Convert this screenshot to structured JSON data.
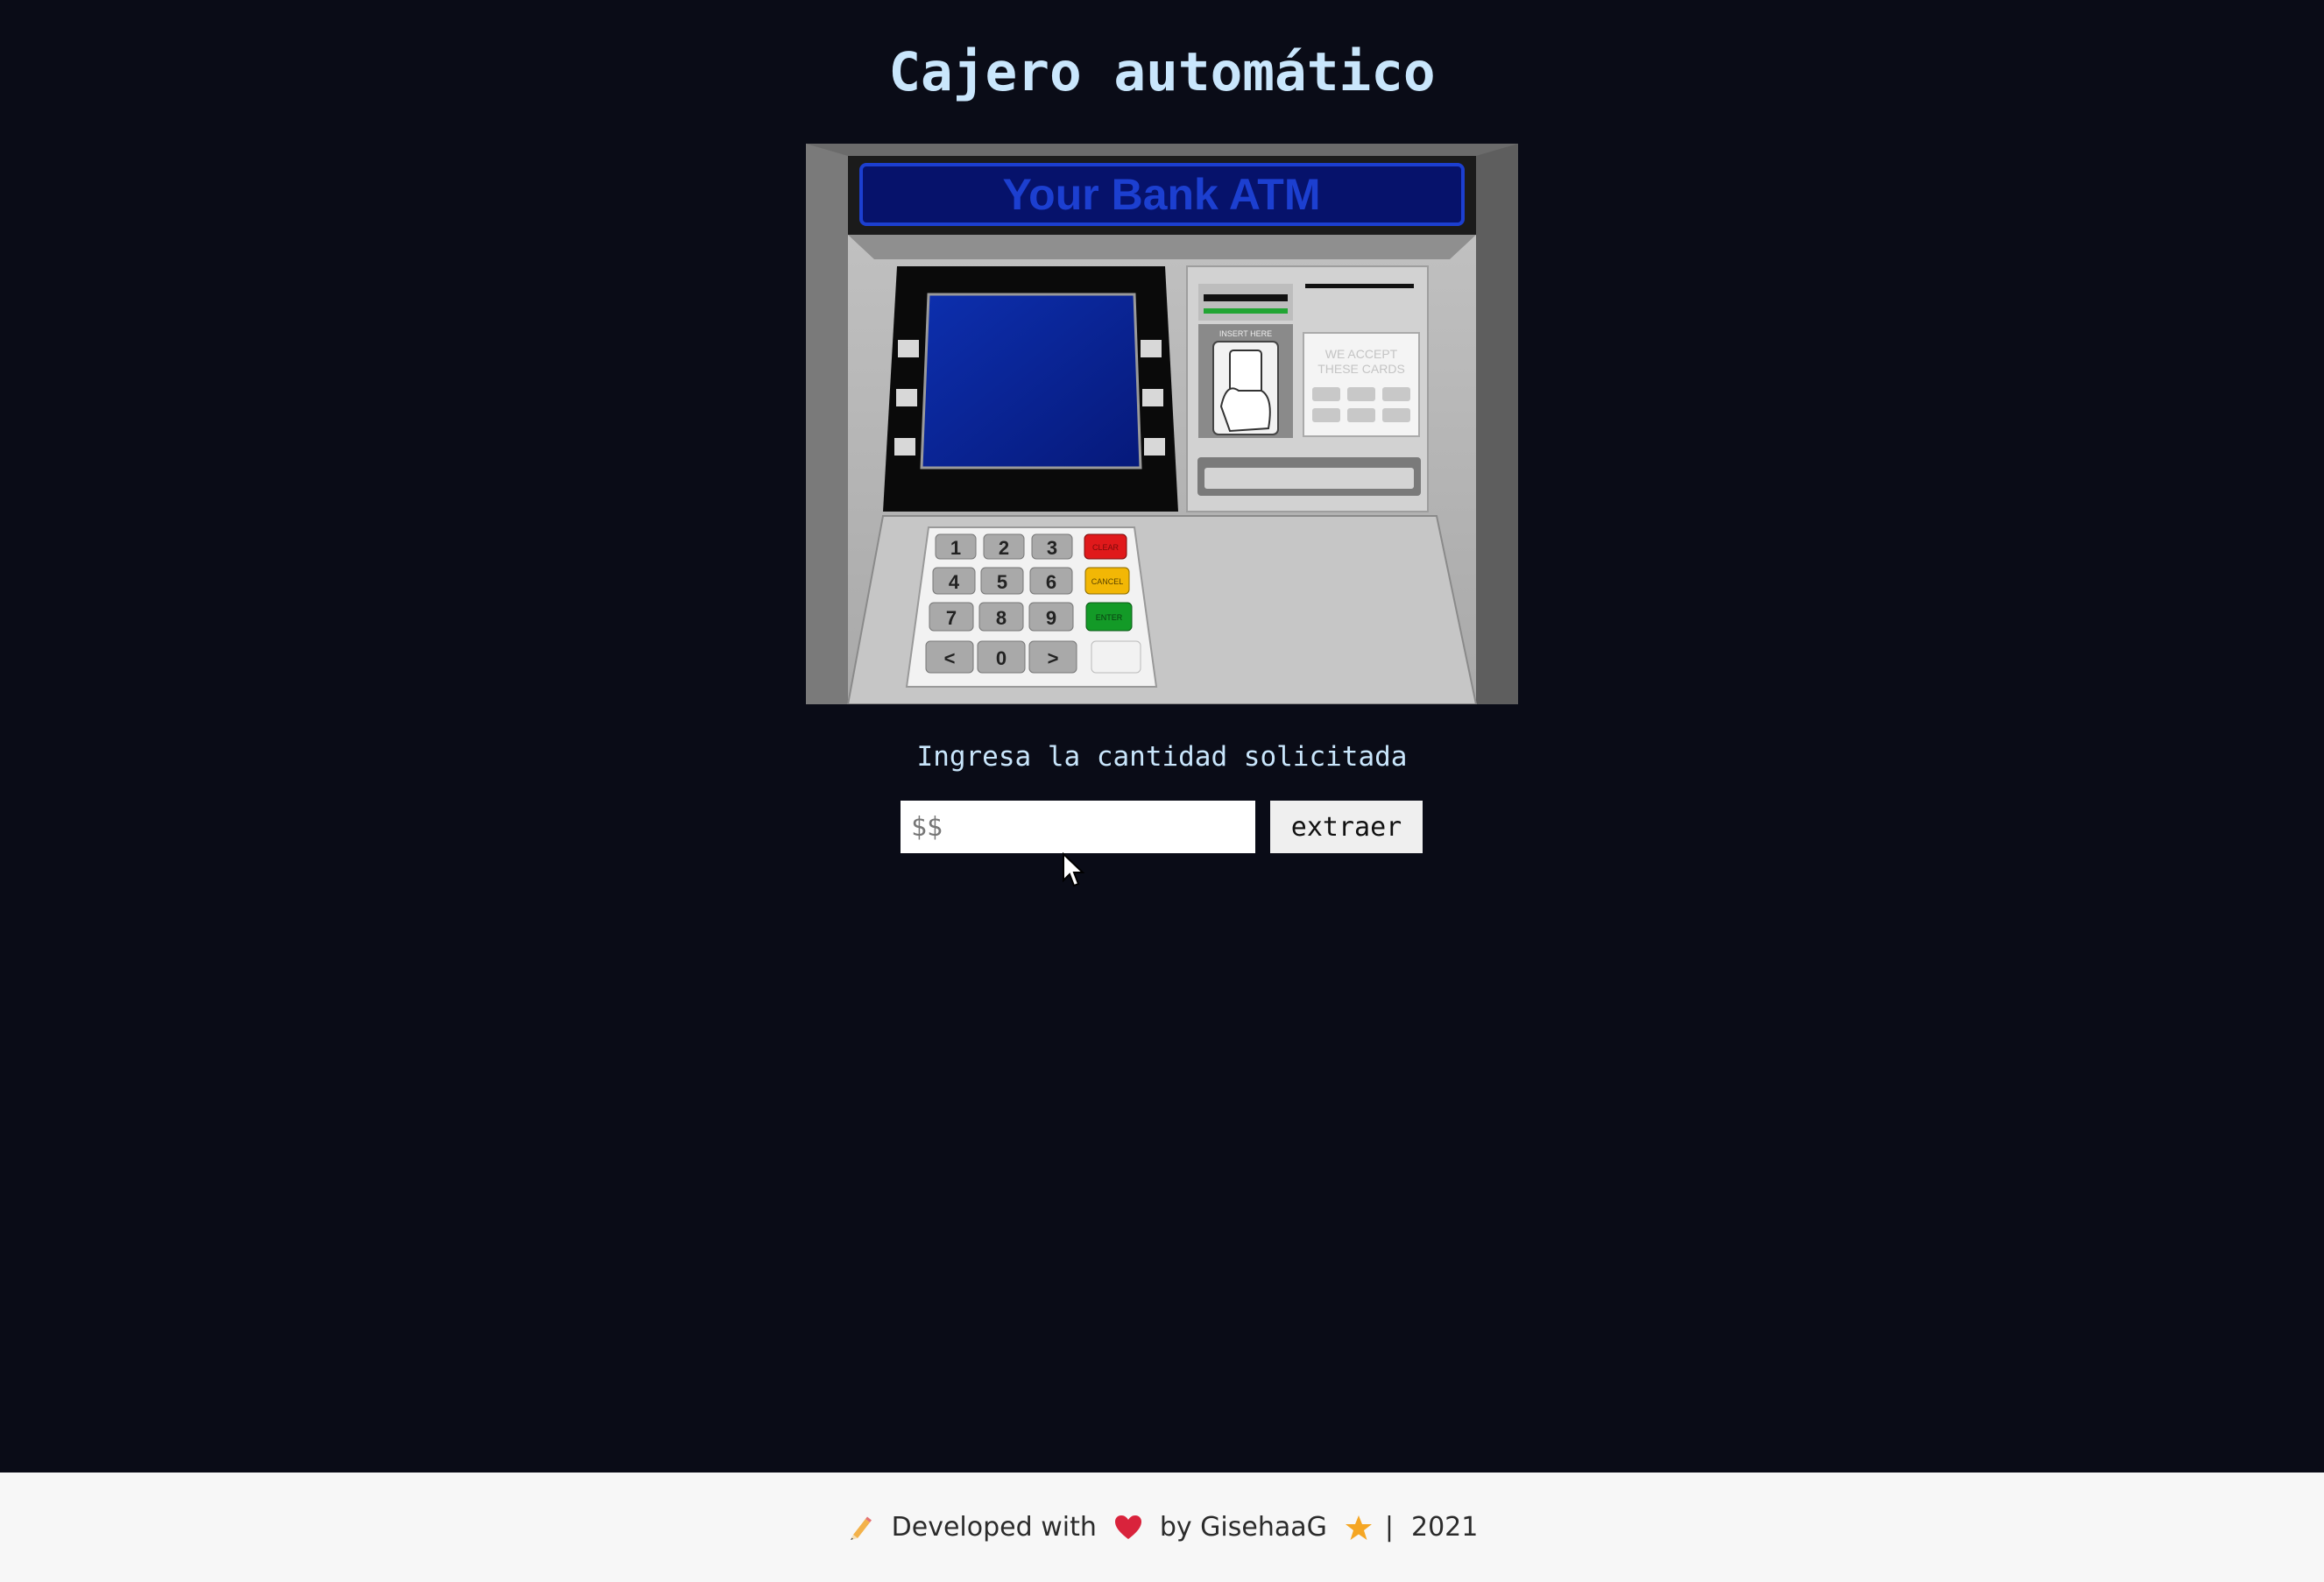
{
  "header": {
    "title": "Cajero automático"
  },
  "atm": {
    "banner_text": "Your Bank ATM",
    "insert_label": "INSERT HERE",
    "accept_label_line1": "WE ACCEPT",
    "accept_label_line2": "THESE CARDS",
    "keypad_keys": [
      "1",
      "2",
      "3",
      "4",
      "5",
      "6",
      "7",
      "8",
      "9",
      "<",
      "0",
      ">"
    ],
    "clear_label": "CLEAR",
    "cancel_label": "CANCEL",
    "enter_label": "ENTER",
    "screen_color": "#0a2a9c",
    "body_color": "#b9b9b9",
    "clear_color": "#e0191b",
    "cancel_color": "#f2b705",
    "enter_color": "#139a27"
  },
  "form": {
    "prompt": "Ingresa la cantidad solicitada",
    "amount_placeholder": "$$",
    "amount_value": "",
    "submit_label": "extraer"
  },
  "footer": {
    "pencil_icon": "pencil-icon",
    "developed_text": "Developed with",
    "heart_icon": "heart-icon",
    "by_text": "by GisehaaG",
    "star_icon": "star-icon",
    "separator": "|",
    "year": "2021",
    "heart_color": "#d9233c",
    "star_color": "#f5a623"
  }
}
